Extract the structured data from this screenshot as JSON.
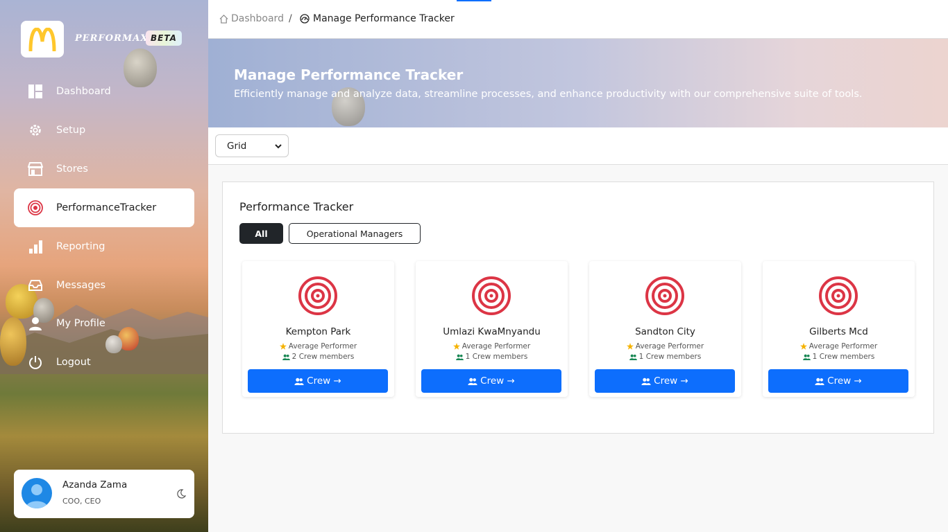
{
  "brand": {
    "name": "PERFORMAX",
    "badge": "BETA",
    "logo_icon": "golden-arches-icon"
  },
  "sidebar": {
    "items": [
      {
        "label": "Dashboard",
        "icon": "dashboard-grid-icon"
      },
      {
        "label": "Setup",
        "icon": "gear-icon"
      },
      {
        "label": "Stores",
        "icon": "store-icon"
      },
      {
        "label": "PerformanceTracker",
        "icon": "target-icon",
        "active": true
      },
      {
        "label": "Reporting",
        "icon": "bar-chart-icon"
      },
      {
        "label": "Messages",
        "icon": "inbox-icon"
      },
      {
        "label": "My Profile",
        "icon": "user-icon"
      },
      {
        "label": "Logout",
        "icon": "power-icon"
      }
    ]
  },
  "user": {
    "name": "Azanda Zama",
    "role": "COO, CEO"
  },
  "breadcrumb": {
    "home": "Dashboard",
    "separator": "/",
    "current": "Manage Performance Tracker"
  },
  "banner": {
    "title": "Manage Performance Tracker",
    "subtitle": "Efficiently manage and analyze data, streamline processes, and enhance productivity with our comprehensive suite of tools."
  },
  "toolbar": {
    "view_mode": "Grid"
  },
  "panel": {
    "title": "Performance Tracker",
    "filters": {
      "all": "All",
      "operational_managers": "Operational Managers"
    },
    "crew_button_label": "Crew →",
    "stores": [
      {
        "name": "Kempton Park",
        "rating": "Average Performer",
        "crew": "2 Crew members"
      },
      {
        "name": "Umlazi KwaMnyandu",
        "rating": "Average Performer",
        "crew": "1 Crew members"
      },
      {
        "name": "Sandton City",
        "rating": "Average Performer",
        "crew": "1 Crew members"
      },
      {
        "name": "Gilberts Mcd",
        "rating": "Average Performer",
        "crew": "1 Crew members"
      }
    ]
  },
  "colors": {
    "accent": "#0d6efd",
    "target_red": "#dc3545",
    "star": "#f5b301",
    "dark": "#212529",
    "mcd_yellow": "#ffc72c"
  }
}
